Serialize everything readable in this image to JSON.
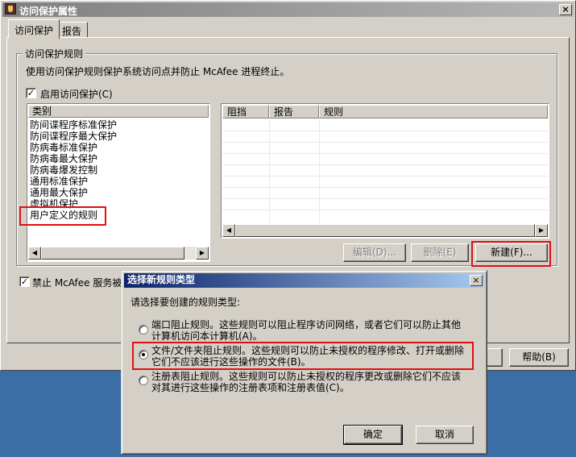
{
  "window": {
    "title": "访问保护属性",
    "close_glyph": "×"
  },
  "tabs": [
    {
      "label": "访问保护",
      "active": true
    },
    {
      "label": "报告",
      "active": false
    }
  ],
  "group": {
    "label": "访问保护规则",
    "description": "使用访问保护规则保护系统访问点并防止 McAfee 进程终止。",
    "enable_checkbox": {
      "label": "启用访问保护(C)",
      "checked": true
    }
  },
  "category_list": {
    "header": "类别",
    "items": [
      "防间谍程序标准保护",
      "防间谍程序最大保护",
      "防病毒标准保护",
      "防病毒最大保护",
      "防病毒爆发控制",
      "通用标准保护",
      "通用最大保护",
      "虚拟机保护",
      "用户定义的规则"
    ],
    "selected": "用户定义的规则"
  },
  "rules_table": {
    "columns": [
      "阻挡",
      "报告",
      "规则"
    ]
  },
  "rule_buttons": {
    "edit": "编辑(D)...",
    "delete": "删除(E)",
    "new": "新建(F)..."
  },
  "bottom_checkbox": {
    "label": "禁止 McAfee 服务被停",
    "checked": true
  },
  "help_button": "帮助(B)",
  "dialog": {
    "title": "选择新规则类型",
    "close_glyph": "×",
    "prompt": "请选择要创建的规则类型:",
    "options": [
      {
        "line1": "端口阻止规则。这些规则可以阻止程序访问网络，或者它们可以防止其他",
        "line2": "计算机访问本计算机(A)。",
        "checked": false
      },
      {
        "line1": "文件/文件夹阻止规则。这些规则可以防止未授权的程序修改、打开或删除",
        "line2": "它们不应该进行这些操作的文件(B)。",
        "checked": true
      },
      {
        "line1": "注册表阻止规则。这些规则可以防止未授权的程序更改或删除它们不应该",
        "line2": "对其进行这些操作的注册表项和注册表值(C)。",
        "checked": false
      }
    ],
    "ok": "确定",
    "cancel": "取消"
  },
  "colors": {
    "window_bg": "#d4d0c8",
    "desktop_bg": "#3a6ea5",
    "dialog_title_bg": "#0a246a",
    "highlight_box": "#e01010"
  },
  "icons": {
    "window_icon": "mcafee-shield-icon",
    "scroll_left": "◀",
    "scroll_right": "▶",
    "check": "✓"
  }
}
